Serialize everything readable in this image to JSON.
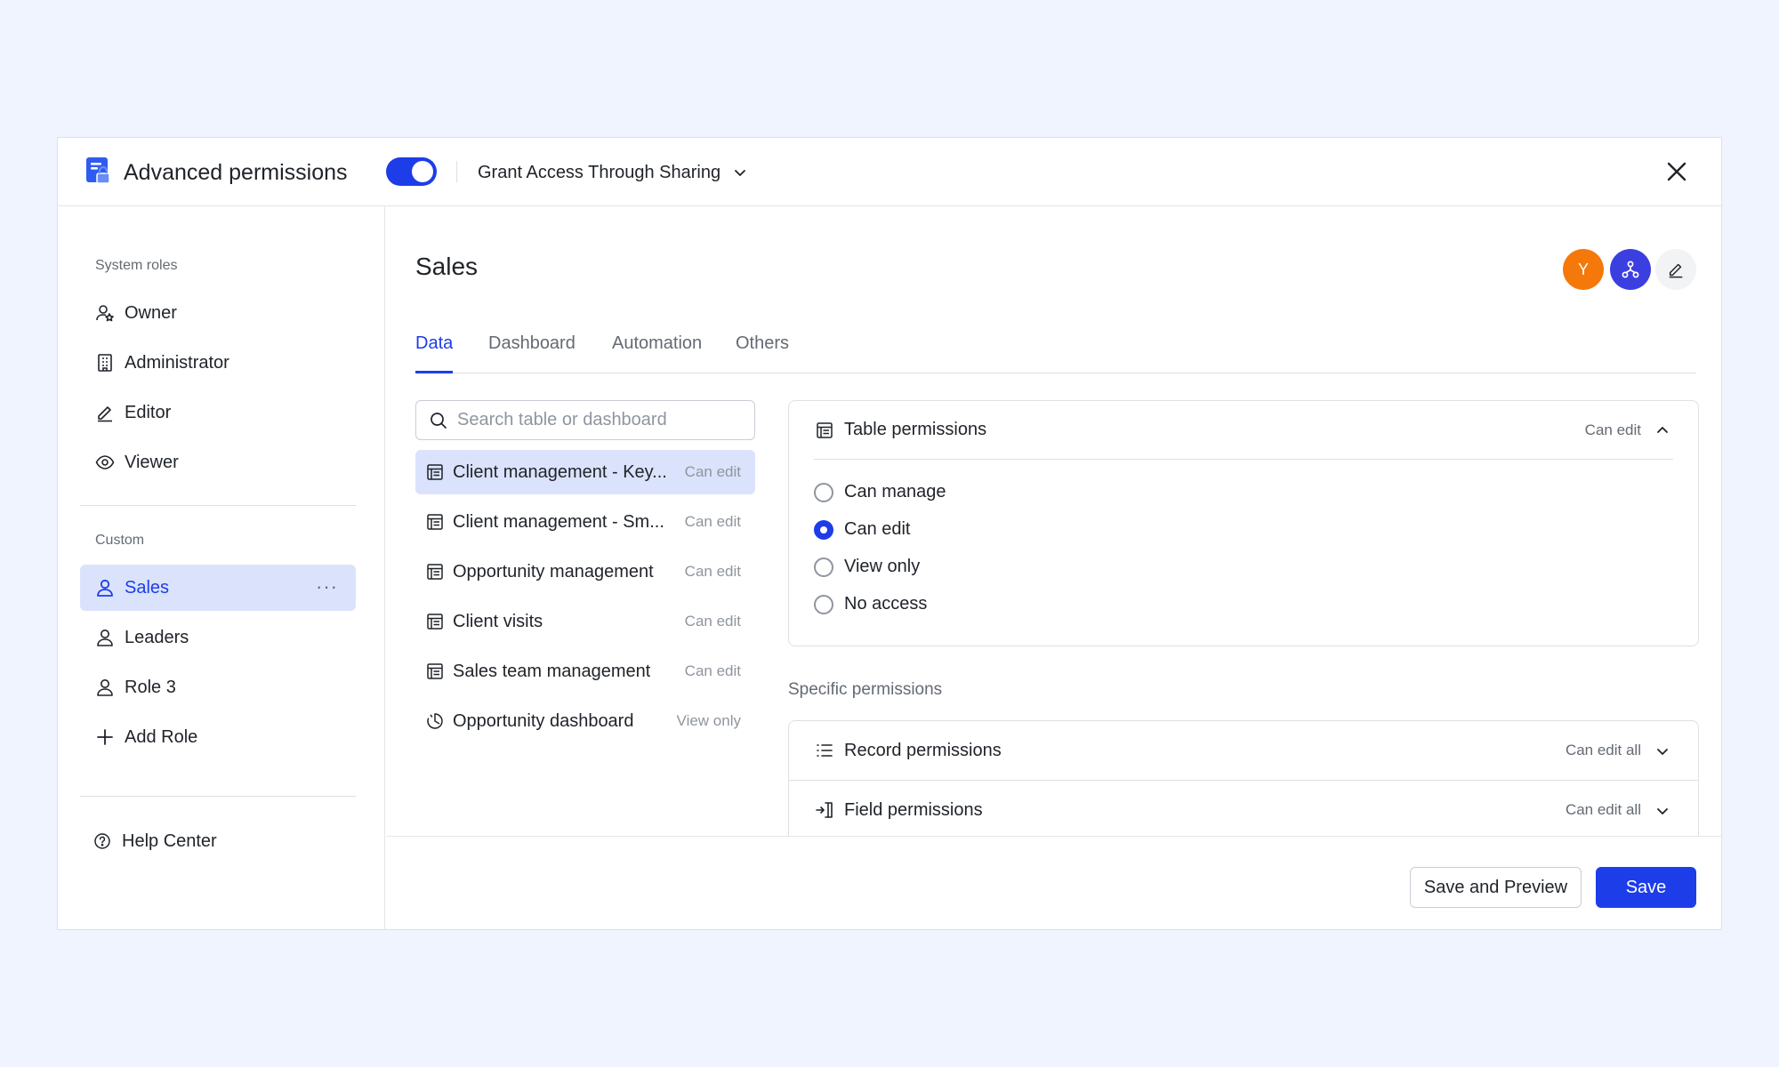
{
  "header": {
    "title": "Advanced permissions",
    "toggle_on": true,
    "grant_label": "Grant Access Through Sharing"
  },
  "sidebar": {
    "system_label": "System roles",
    "system_roles": [
      {
        "label": "Owner",
        "icon": "user-star-icon"
      },
      {
        "label": "Administrator",
        "icon": "building-icon"
      },
      {
        "label": "Editor",
        "icon": "pencil-icon"
      },
      {
        "label": "Viewer",
        "icon": "eye-icon"
      }
    ],
    "custom_label": "Custom",
    "custom_roles": [
      {
        "label": "Sales",
        "icon": "user-icon",
        "active": true
      },
      {
        "label": "Leaders",
        "icon": "user-icon"
      },
      {
        "label": "Role 3",
        "icon": "user-icon"
      }
    ],
    "add_role": "Add Role",
    "help": "Help Center"
  },
  "main": {
    "role_title": "Sales",
    "avatar_letter": "Y",
    "tabs": [
      "Data",
      "Dashboard",
      "Automation",
      "Others"
    ],
    "active_tab": "Data",
    "search_placeholder": "Search table or dashboard",
    "items": [
      {
        "name": "Client management - Key...",
        "perm": "Can edit",
        "icon": "table-icon",
        "active": true
      },
      {
        "name": "Client management - Sm...",
        "perm": "Can edit",
        "icon": "table-icon"
      },
      {
        "name": "Opportunity management",
        "perm": "Can edit",
        "icon": "table-icon"
      },
      {
        "name": "Client visits",
        "perm": "Can edit",
        "icon": "table-icon"
      },
      {
        "name": "Sales team management",
        "perm": "Can edit",
        "icon": "table-icon"
      },
      {
        "name": "Opportunity dashboard",
        "perm": "View only",
        "icon": "dashboard-icon"
      }
    ],
    "table_permissions": {
      "label": "Table permissions",
      "value": "Can edit",
      "options": [
        "Can manage",
        "Can edit",
        "View only",
        "No access"
      ],
      "selected": "Can edit"
    },
    "specific_label": "Specific permissions",
    "record_permissions": {
      "label": "Record permissions",
      "value": "Can edit all"
    },
    "field_permissions": {
      "label": "Field permissions",
      "value": "Can edit all"
    }
  },
  "footer": {
    "save_preview": "Save and Preview",
    "save": "Save"
  },
  "colors": {
    "accent": "#1d3de9",
    "active_bg": "#dbe3fc",
    "avatar_orange": "#f5780a",
    "avatar_blue": "#3b3fe0"
  }
}
